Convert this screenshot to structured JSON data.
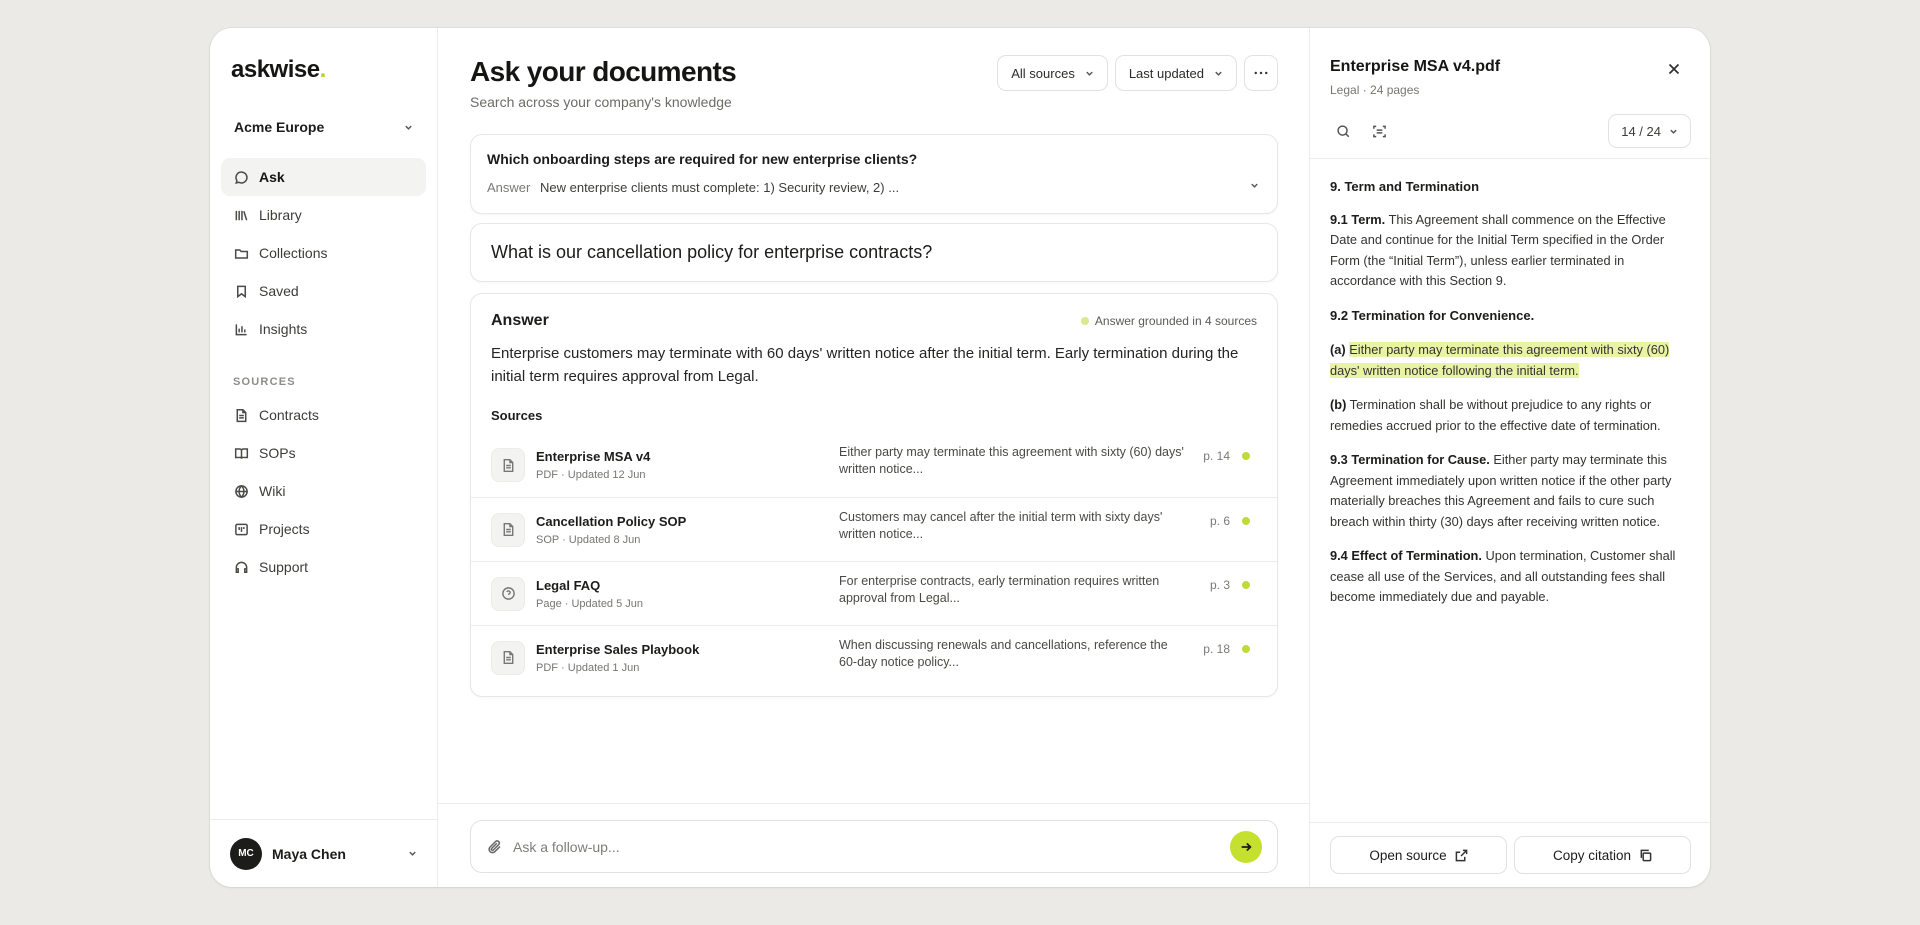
{
  "sidebar": {
    "logo": "askwise",
    "logo_dot": ".",
    "workspace": "Acme Europe",
    "nav": [
      {
        "label": "Ask",
        "icon": "chat-bubble-icon",
        "active": true
      },
      {
        "label": "Library",
        "icon": "library-icon"
      },
      {
        "label": "Collections",
        "icon": "folder-icon"
      },
      {
        "label": "Saved",
        "icon": "bookmark-icon"
      },
      {
        "label": "Insights",
        "icon": "bar-chart-icon"
      }
    ],
    "sources_label": "SOURCES",
    "sources": [
      {
        "label": "Contracts",
        "icon": "document-icon"
      },
      {
        "label": "SOPs",
        "icon": "book-icon"
      },
      {
        "label": "Wiki",
        "icon": "globe-icon"
      },
      {
        "label": "Projects",
        "icon": "kanban-icon"
      },
      {
        "label": "Support",
        "icon": "headset-icon"
      }
    ],
    "user": {
      "initials": "MC",
      "name": "Maya Chen"
    }
  },
  "main": {
    "title": "Ask your documents",
    "subtitle": "Search across your company's knowledge",
    "filters": {
      "sources": "All sources",
      "sort": "Last updated"
    },
    "previous": {
      "question": "Which onboarding steps are required for new enterprise clients?",
      "answer_label": "Answer",
      "answer_preview": "New enterprise clients must complete: 1) Security review, 2) ..."
    },
    "question": "What is our cancellation policy for enterprise contracts?",
    "answer": {
      "title": "Answer",
      "grounded": "Answer grounded in 4 sources",
      "text": "Enterprise customers may terminate with 60 days' written notice after the initial term. Early termination during the initial term requires approval from Legal.",
      "sources_label": "Sources",
      "sources": [
        {
          "name": "Enterprise MSA v4",
          "meta": "PDF · Updated 12 Jun",
          "snippet": "Either party may terminate this agreement with sixty (60) days' written notice...",
          "page": "p. 14",
          "icon": "document-icon"
        },
        {
          "name": "Cancellation Policy SOP",
          "meta": "SOP · Updated 8 Jun",
          "snippet": "Customers may cancel after the initial term with sixty days' written notice...",
          "page": "p. 6",
          "icon": "document-icon"
        },
        {
          "name": "Legal FAQ",
          "meta": "Page · Updated 5 Jun",
          "snippet": "For enterprise contracts, early termination requires written approval from Legal...",
          "page": "p. 3",
          "icon": "question-circle-icon"
        },
        {
          "name": "Enterprise Sales Playbook",
          "meta": "PDF · Updated 1 Jun",
          "snippet": "When discussing renewals and cancellations, reference the 60-day notice policy...",
          "page": "p. 18",
          "icon": "document-icon"
        }
      ]
    },
    "composer": {
      "placeholder": "Ask a follow-up..."
    }
  },
  "preview": {
    "title": "Enterprise MSA v4.pdf",
    "meta": "Legal · 24 pages",
    "page_indicator": "14 / 24",
    "heading": "9. Term and Termination",
    "s91_label": "9.1 Term.",
    "s91_text": " This Agreement shall commence on the Effective Date and continue for the Initial Term specified in the Order Form (the “Initial Term”), unless earlier terminated in accordance with this Section 9.",
    "s92_heading": "9.2 Termination for Convenience.",
    "s92a_label": "(a)",
    "s92a_text": "Either party may terminate this agreement with sixty (60) days' written notice following the initial term.",
    "s92b_label": "(b)",
    "s92b_text": " Termination shall be without prejudice to any rights or remedies accrued prior to the effective date of termination.",
    "s93_label": "9.3 Termination for Cause.",
    "s93_text": " Either party may terminate this Agreement immediately upon written notice if the other party materially breaches this Agreement and fails to cure such breach within thirty (30) days after receiving written notice.",
    "s94_label": "9.4 Effect of Termination.",
    "s94_text": " Upon termination, Customer shall cease all use of the Services, and all outstanding fees shall become immediately due and payable.",
    "open_source": "Open source",
    "copy_citation": "Copy citation"
  },
  "colors": {
    "accent": "#c6e030",
    "highlight": "#e8f3a6",
    "status_dot": "#c2d93a"
  }
}
